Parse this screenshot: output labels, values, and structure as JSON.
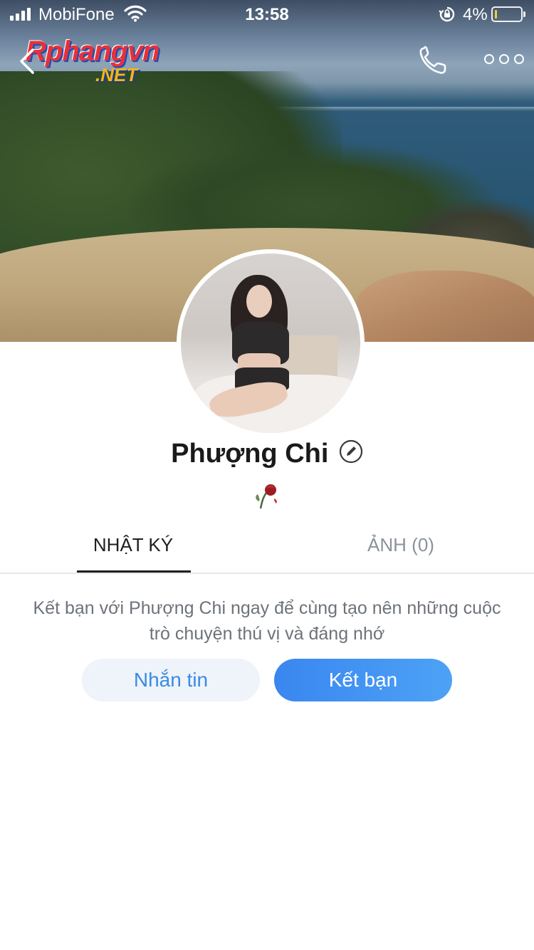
{
  "status_bar": {
    "carrier": "MobiFone",
    "time": "13:58",
    "battery_percent": "4%",
    "battery_level": 0.04,
    "icons": [
      "signal-icon",
      "wifi-icon",
      "orientation-lock-icon",
      "battery-icon"
    ]
  },
  "watermark": {
    "line1": "Rphangvn",
    "line2": ".NET"
  },
  "navbar": {
    "icons": [
      "back-chevron-icon",
      "phone-icon",
      "more-options-icon"
    ]
  },
  "profile": {
    "name": "Phượng Chi",
    "status_emoji": "🥀"
  },
  "tabs": [
    {
      "label": "NHẬT KÝ",
      "active": true
    },
    {
      "label": "ẢNH (0)",
      "active": false
    }
  ],
  "invite_text": {
    "line1": "Kết bạn với Phượng Chi ngay để cùng tạo nên những cuộc",
    "line2": "trò chuyện thú vị và đáng nhớ"
  },
  "actions": {
    "message_label": "Nhắn tin",
    "add_friend_label": "Kết bạn"
  },
  "colors": {
    "accent": "#3a86f0",
    "message_button_bg": "#eef4f9",
    "text_primary": "#1a1a1a",
    "text_secondary": "#6d7379",
    "tab_inactive": "#8b9299"
  }
}
